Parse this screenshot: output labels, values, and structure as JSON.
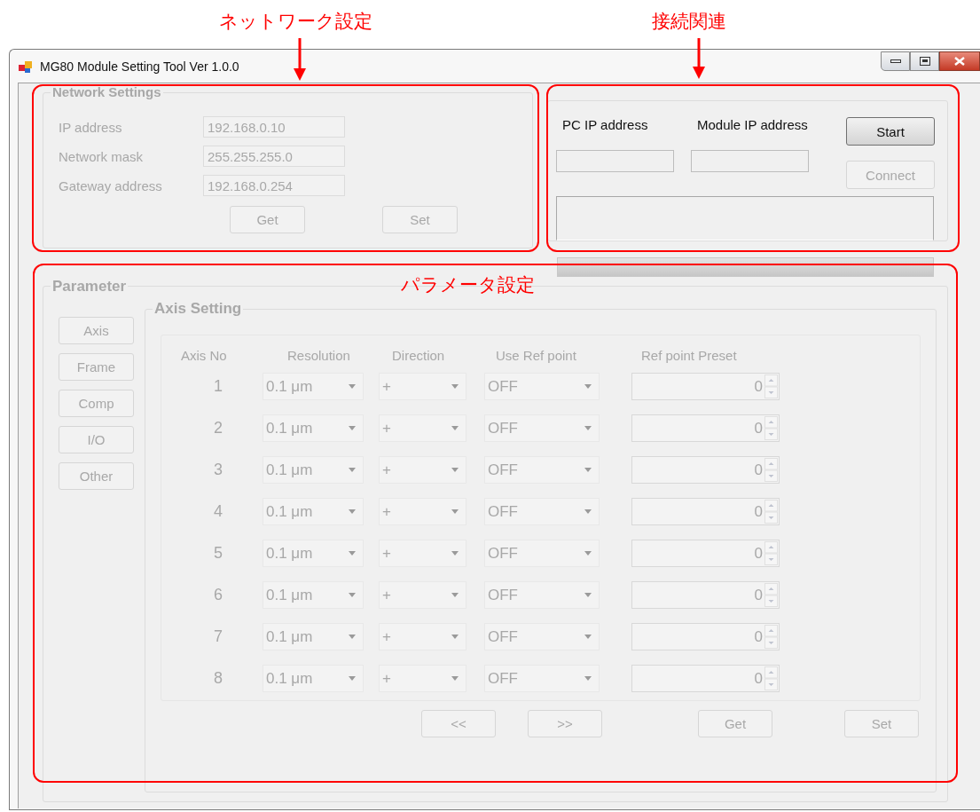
{
  "annotations": [
    {
      "text": "ネットワーク設定"
    },
    {
      "text": "接続関連"
    },
    {
      "text": "パラメータ設定"
    }
  ],
  "window": {
    "title": "MG80 Module Setting Tool Ver 1.0.0"
  },
  "network_settings": {
    "title": "Network Settings",
    "disabled": true,
    "fields": [
      {
        "label": "IP address",
        "value": "192.168.0.10"
      },
      {
        "label": "Network mask",
        "value": "255.255.255.0"
      },
      {
        "label": "Gateway address",
        "value": "192.168.0.254"
      }
    ],
    "buttons": [
      {
        "label": "Get"
      },
      {
        "label": "Set"
      }
    ]
  },
  "connection": {
    "pc_ip_label": "PC IP address",
    "module_ip_label": "Module IP address",
    "buttons": [
      {
        "label": "Start",
        "disabled": false
      },
      {
        "label": "Connect",
        "disabled": true
      }
    ]
  },
  "progress": {
    "level": 0
  },
  "parameter": {
    "title": "Parameter",
    "disabled": true,
    "nav": [
      {
        "label": "Axis"
      },
      {
        "label": "Frame"
      },
      {
        "label": "Comp"
      },
      {
        "label": "I/O"
      },
      {
        "label": "Other"
      }
    ],
    "axis_setting": {
      "title": "Axis Setting",
      "columns": [
        "Axis No",
        "Resolution",
        "Direction",
        "Use Ref point",
        "Ref point Preset"
      ],
      "rows": [
        {
          "axis_no": "1",
          "resolution": "0.1 μm",
          "direction": "+",
          "use_ref_point": "OFF",
          "ref_point_preset": "0"
        },
        {
          "axis_no": "2",
          "resolution": "0.1 μm",
          "direction": "+",
          "use_ref_point": "OFF",
          "ref_point_preset": "0"
        },
        {
          "axis_no": "3",
          "resolution": "0.1 μm",
          "direction": "+",
          "use_ref_point": "OFF",
          "ref_point_preset": "0"
        },
        {
          "axis_no": "4",
          "resolution": "0.1 μm",
          "direction": "+",
          "use_ref_point": "OFF",
          "ref_point_preset": "0"
        },
        {
          "axis_no": "5",
          "resolution": "0.1 μm",
          "direction": "+",
          "use_ref_point": "OFF",
          "ref_point_preset": "0"
        },
        {
          "axis_no": "6",
          "resolution": "0.1 μm",
          "direction": "+",
          "use_ref_point": "OFF",
          "ref_point_preset": "0"
        },
        {
          "axis_no": "7",
          "resolution": "0.1 μm",
          "direction": "+",
          "use_ref_point": "OFF",
          "ref_point_preset": "0"
        },
        {
          "axis_no": "8",
          "resolution": "0.1 μm",
          "direction": "+",
          "use_ref_point": "OFF",
          "ref_point_preset": "0"
        }
      ],
      "buttons": [
        {
          "label": "<<"
        },
        {
          "label": ">>"
        },
        {
          "label": "Get"
        },
        {
          "label": "Set"
        }
      ]
    }
  }
}
